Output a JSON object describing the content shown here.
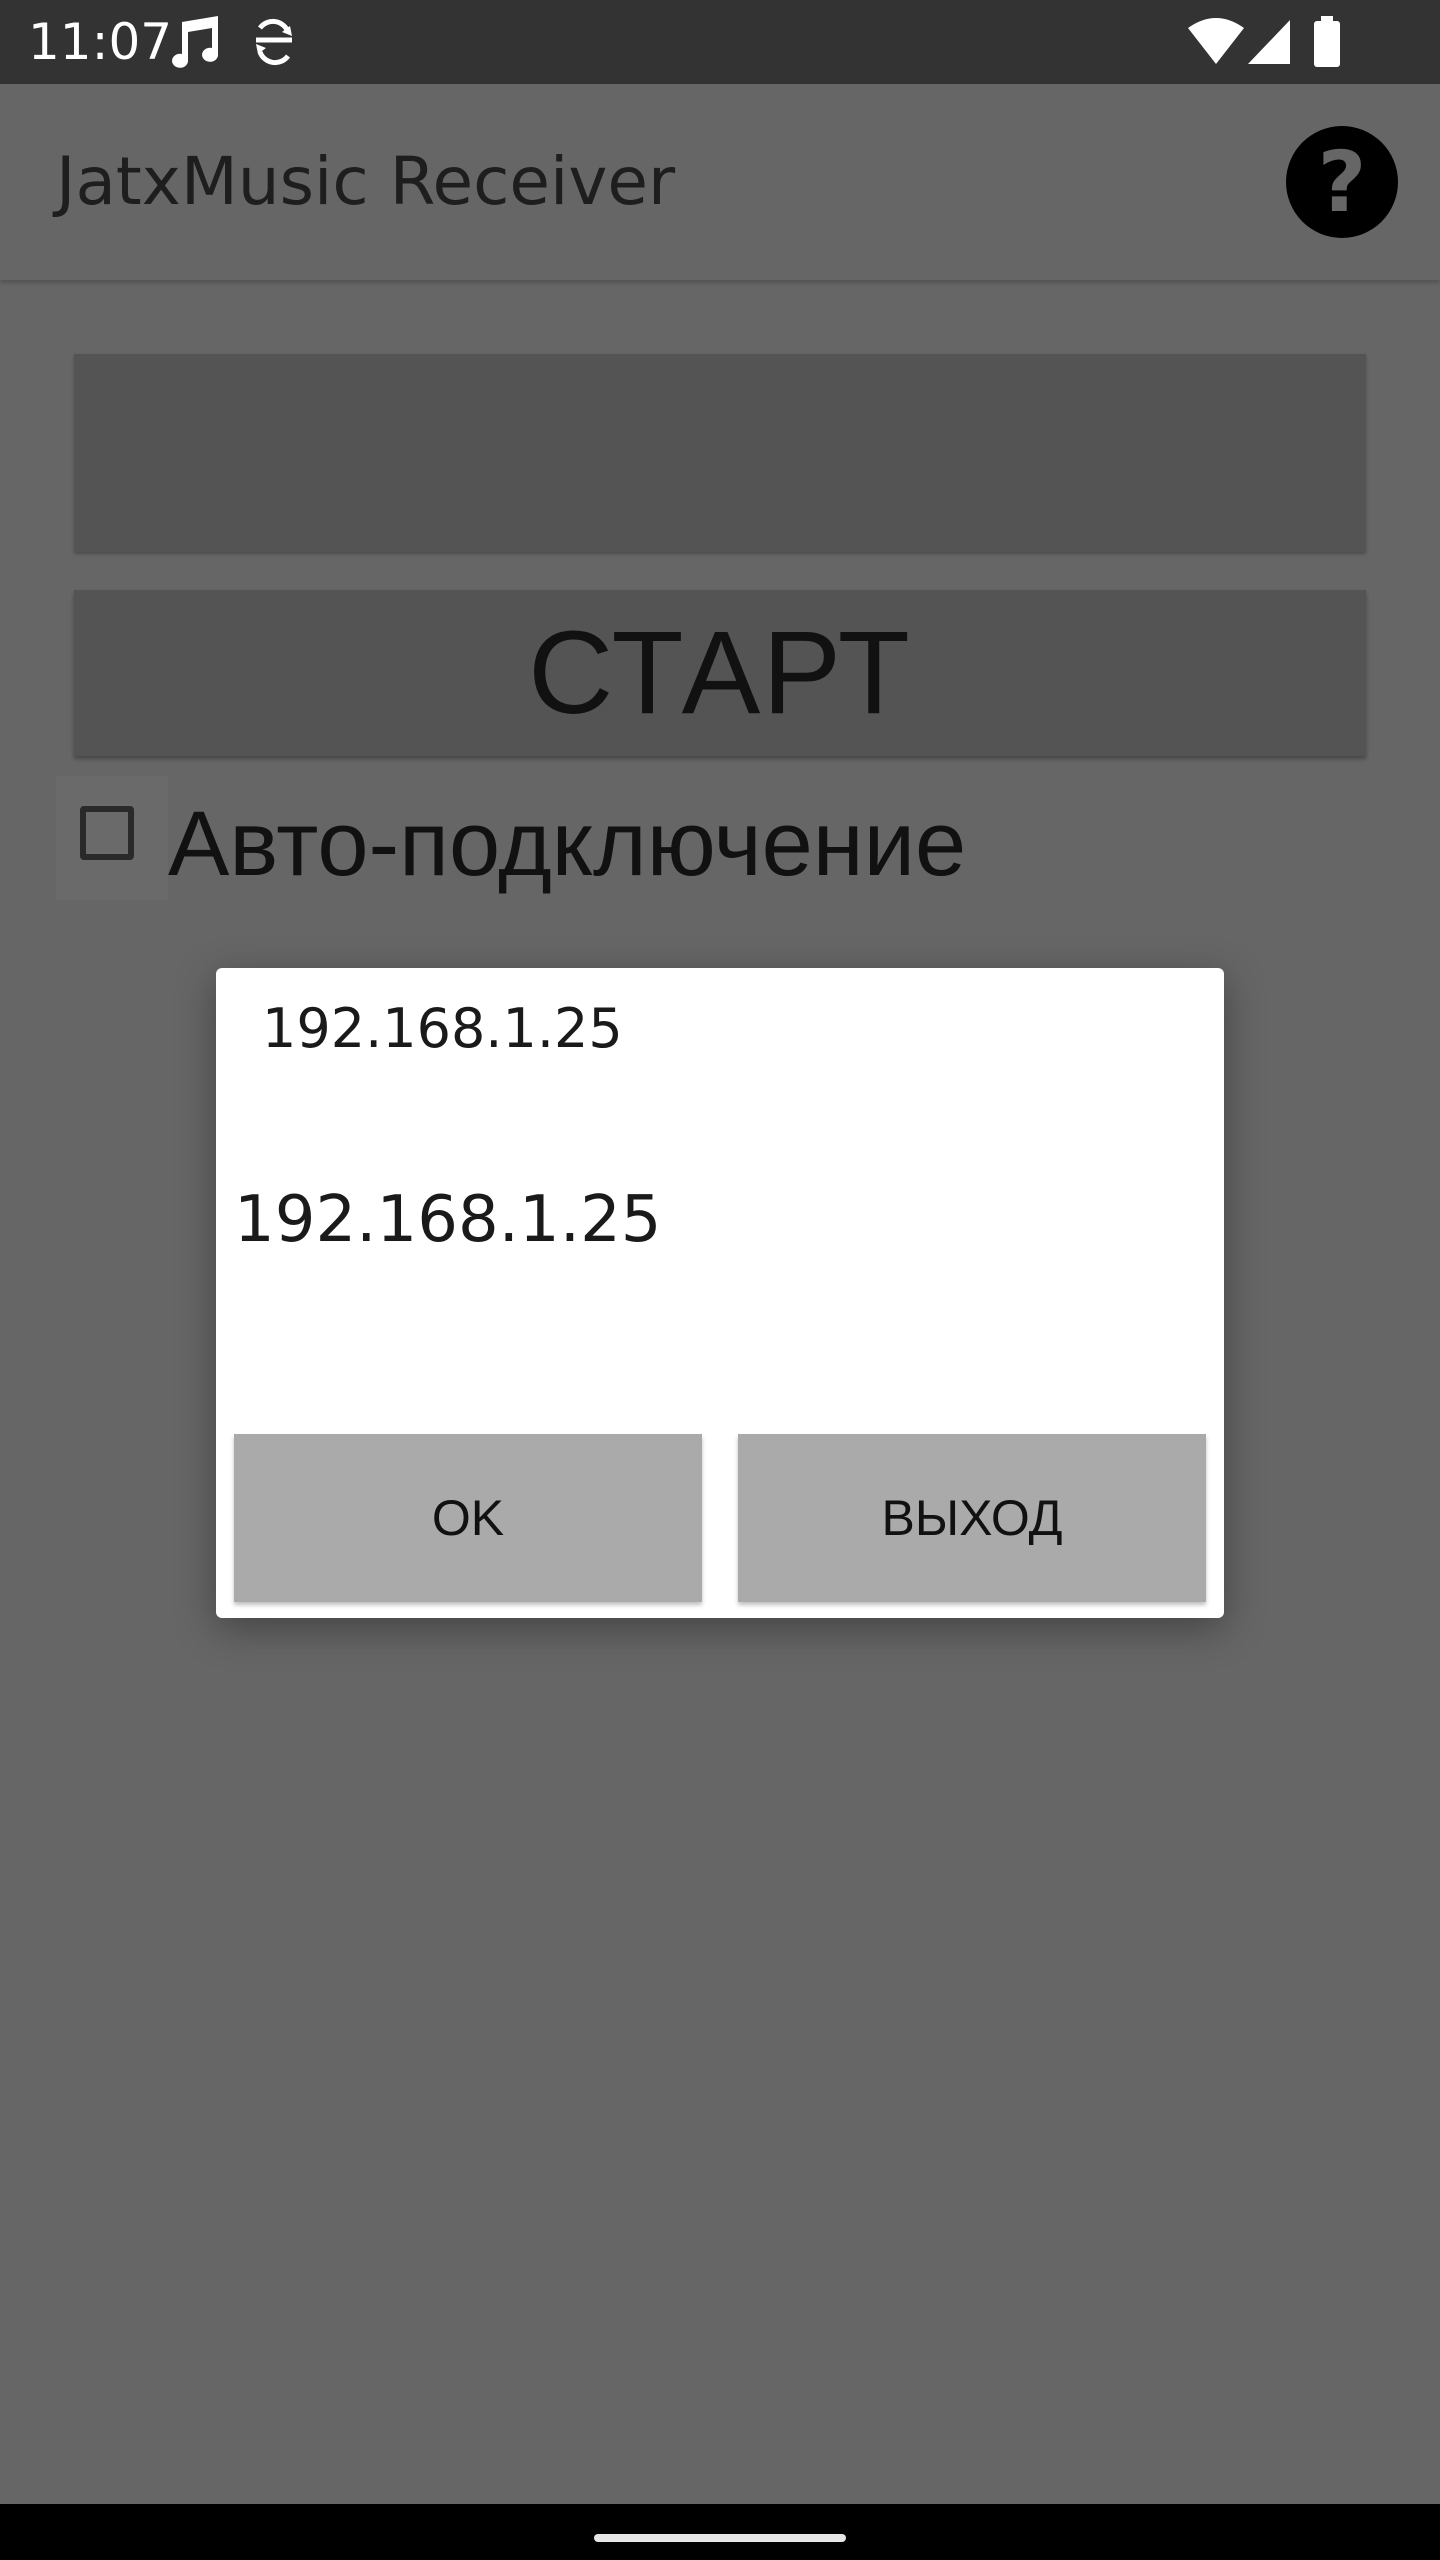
{
  "status_bar": {
    "time": "11:07",
    "icons": [
      "music-note-icon",
      "sync-icon",
      "wifi-icon",
      "signal-icon",
      "battery-icon"
    ]
  },
  "app_bar": {
    "title": "JatxMusic Receiver",
    "help_symbol": "?"
  },
  "main": {
    "ip_input_value": "",
    "start_label": "СТАРТ",
    "autoconnect_label": "Авто-подключение",
    "autoconnect_checked": false
  },
  "dialog": {
    "edit_value": "192.168.1.25",
    "message": "192.168.1.25",
    "ok_label": "OK",
    "exit_label": "ВЫХОД"
  },
  "colors": {
    "scrim_background": "#666666",
    "status_bar": "#333333",
    "button_background": "#545454",
    "dialog_button": "#aaaaaa"
  }
}
